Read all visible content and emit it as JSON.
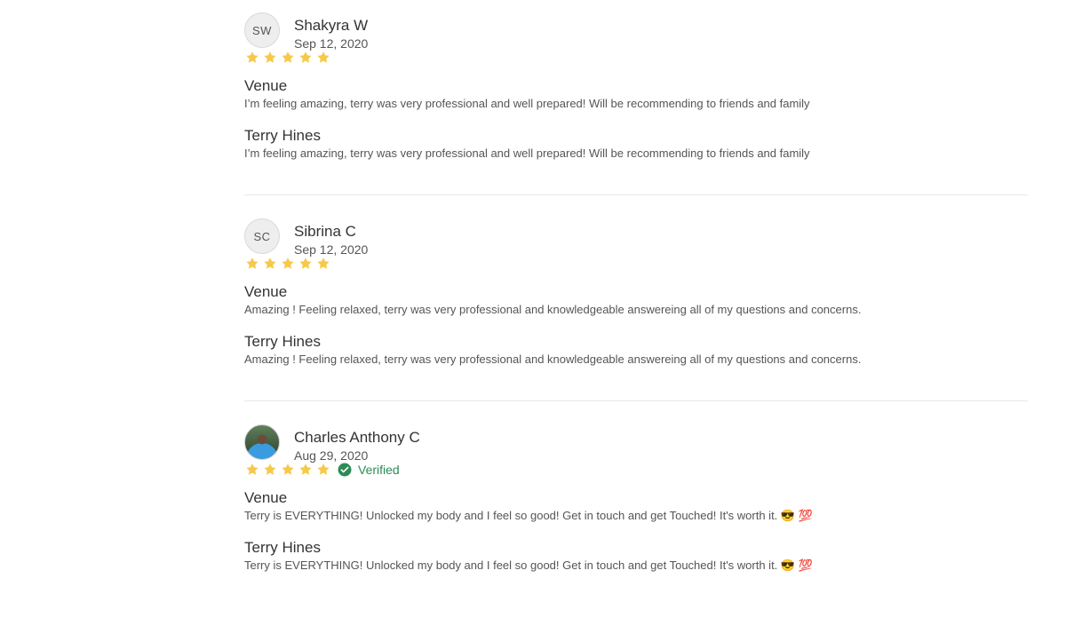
{
  "reviews": [
    {
      "avatar_initials": "SW",
      "avatar_type": "initials",
      "name": "Shakyra W",
      "date": "Sep 12, 2020",
      "rating": 5,
      "verified": false,
      "sections": [
        {
          "title": "Venue",
          "text": "I’m feeling amazing, terry was very professional and well prepared! Will be recommending to friends and family"
        },
        {
          "title": "Terry Hines",
          "text": "I’m feeling amazing, terry was very professional and well prepared! Will be recommending to friends and family"
        }
      ]
    },
    {
      "avatar_initials": "SC",
      "avatar_type": "initials",
      "name": "Sibrina C",
      "date": "Sep 12, 2020",
      "rating": 5,
      "verified": false,
      "sections": [
        {
          "title": "Venue",
          "text": "Amazing ! Feeling relaxed, terry was very professional and knowledgeable answereing all of my questions and concerns."
        },
        {
          "title": "Terry Hines",
          "text": "Amazing ! Feeling relaxed, terry was very professional and knowledgeable answereing all of my questions and concerns."
        }
      ]
    },
    {
      "avatar_initials": "",
      "avatar_type": "photo",
      "name": "Charles Anthony C",
      "date": "Aug 29, 2020",
      "rating": 5,
      "verified": true,
      "verified_label": "Verified",
      "sections": [
        {
          "title": "Venue",
          "text": "Terry is EVERYTHING! Unlocked my body and I feel so good! Get in touch and get Touched! It's worth it. 😎 💯"
        },
        {
          "title": "Terry Hines",
          "text": "Terry is EVERYTHING! Unlocked my body and I feel so good! Get in touch and get Touched! It's worth it. 😎 💯"
        }
      ]
    }
  ],
  "colors": {
    "star": "#f6c94b",
    "verified": "#2e8b57",
    "divider": "#e7e7e7",
    "text": "#333333",
    "muted": "#555555"
  },
  "icons": {
    "star": "star-icon",
    "verified": "check-circle-icon",
    "avatar": "avatar"
  }
}
